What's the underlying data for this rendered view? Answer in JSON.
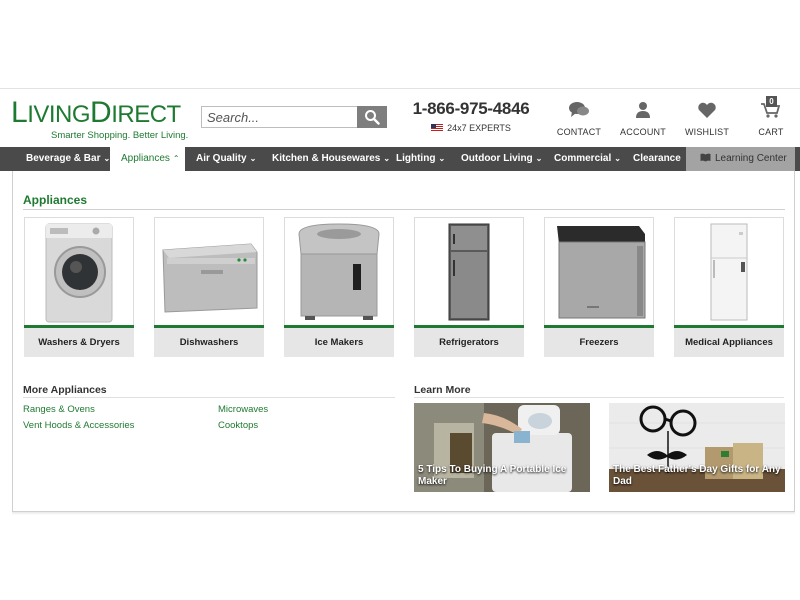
{
  "header": {
    "logo": {
      "first_big": "L",
      "first_rest": "IVING",
      "second_big": "D",
      "second_rest": "IRECT",
      "tagline": "Smarter Shopping. Better Living."
    },
    "search": {
      "placeholder": "Search..."
    },
    "phone": {
      "number": "1-866-975-4846",
      "experts": "24x7 EXPERTS"
    },
    "utilities": [
      {
        "label": "CONTACT",
        "icon": "chat-bubbles-icon"
      },
      {
        "label": "ACCOUNT",
        "icon": "user-icon"
      },
      {
        "label": "WISHLIST",
        "icon": "heart-icon"
      },
      {
        "label": "CART",
        "icon": "cart-icon",
        "count": "0"
      }
    ]
  },
  "nav": {
    "items": [
      {
        "label": "Beverage & Bar",
        "caret": "⌄"
      },
      {
        "label": "Appliances",
        "caret": "⌃"
      },
      {
        "label": "Air Quality",
        "caret": "⌄"
      },
      {
        "label": "Kitchen & Housewares",
        "caret": "⌄"
      },
      {
        "label": "Lighting",
        "caret": "⌄"
      },
      {
        "label": "Outdoor Living",
        "caret": "⌄"
      },
      {
        "label": "Commercial",
        "caret": "⌄"
      },
      {
        "label": "Clearance"
      },
      {
        "label": "Learning Center",
        "icon": "book-icon"
      }
    ]
  },
  "dropdown": {
    "title": "Appliances",
    "categories": [
      {
        "label": "Washers & Dryers"
      },
      {
        "label": "Dishwashers"
      },
      {
        "label": "Ice Makers"
      },
      {
        "label": "Refrigerators"
      },
      {
        "label": "Freezers"
      },
      {
        "label": "Medical Appliances"
      }
    ],
    "more": {
      "heading": "More Appliances",
      "links": [
        "Ranges & Ovens",
        "Microwaves",
        "Vent Hoods & Accessories",
        "Cooktops"
      ]
    },
    "learn": {
      "heading": "Learn More",
      "articles": [
        {
          "caption": "5 Tips To Buying A Portable Ice Maker"
        },
        {
          "caption": "The Best Father's Day Gifts for Any Dad"
        }
      ]
    }
  },
  "colors": {
    "brand_green": "#1f7a31",
    "nav_bg": "#4a4a4a",
    "learn_bg": "#a3a3a3",
    "label_bg": "#e6e6e6"
  }
}
